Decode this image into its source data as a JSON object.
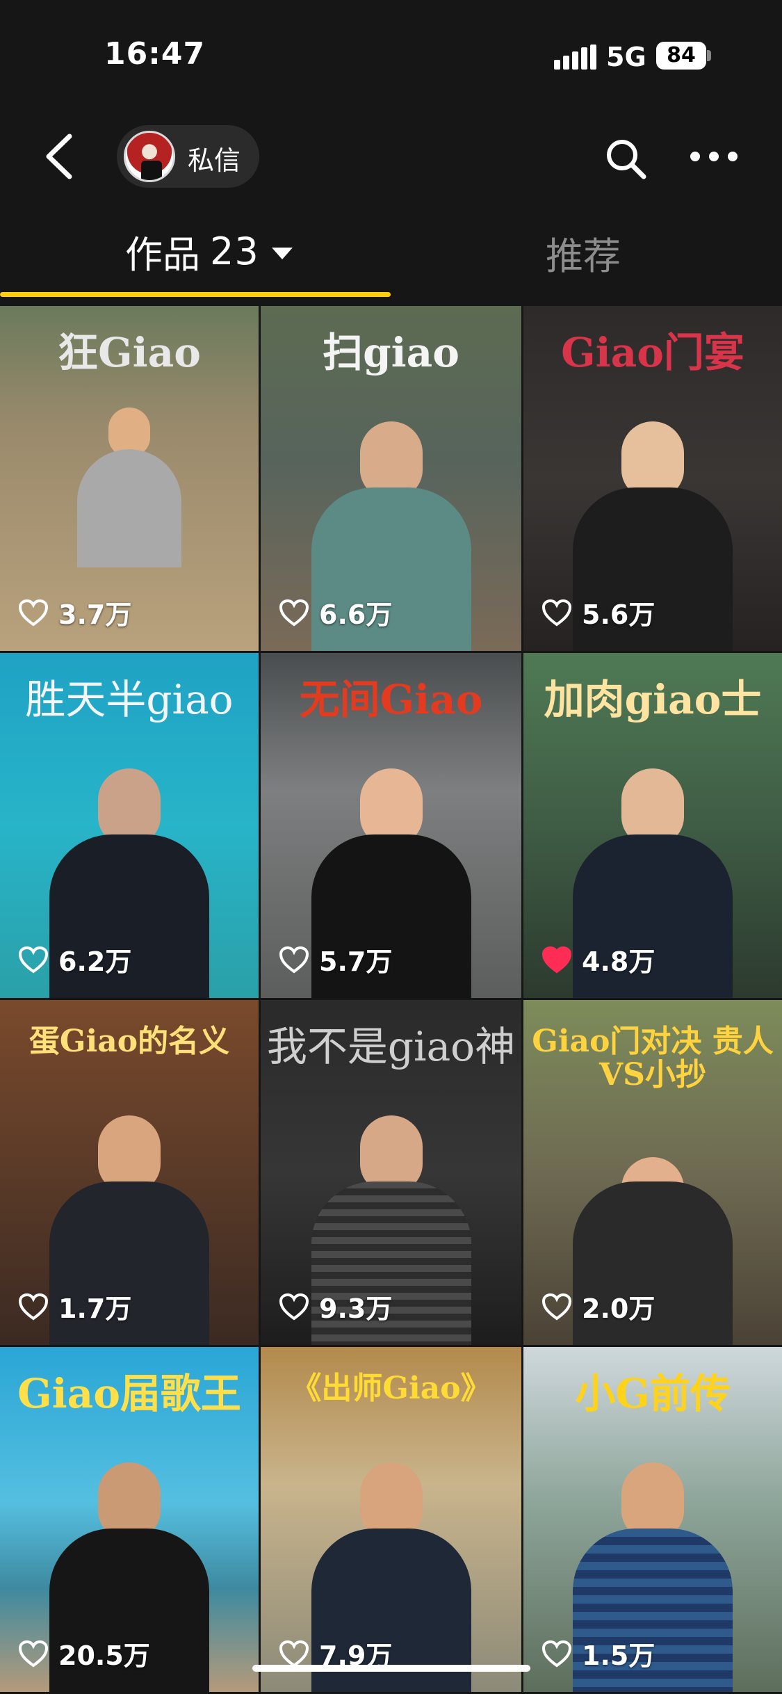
{
  "status_bar": {
    "time": "16:47",
    "network": "5G",
    "battery": "84"
  },
  "header": {
    "chat_label": "私信"
  },
  "tabs": {
    "works_label": "作品",
    "works_count": "23",
    "recommend_label": "推荐"
  },
  "colors": {
    "accent": "#ffcf0d",
    "liked": "#ff2d55"
  },
  "videos": [
    {
      "title": "狂Giao",
      "likes": "3.7万",
      "liked": false
    },
    {
      "title": "扫giao",
      "likes": "6.6万",
      "liked": false
    },
    {
      "title": "Giao门宴",
      "likes": "5.6万",
      "liked": false
    },
    {
      "title": "胜天半giao",
      "likes": "6.2万",
      "liked": false
    },
    {
      "title": "无间Giao",
      "likes": "5.7万",
      "liked": false
    },
    {
      "title": "加肉giao士",
      "likes": "4.8万",
      "liked": true
    },
    {
      "title": "蛋Giao的名义",
      "likes": "1.7万",
      "liked": false
    },
    {
      "title": "我不是giao神",
      "likes": "9.3万",
      "liked": false
    },
    {
      "title": "Giao门对决 贵人VS小抄",
      "likes": "2.0万",
      "liked": false
    },
    {
      "title": "Giao届歌王",
      "likes": "20.5万",
      "liked": false
    },
    {
      "title": "《出师Giao》",
      "likes": "7.9万",
      "liked": false
    },
    {
      "title": "小G前传",
      "likes": "1.5万",
      "liked": false
    }
  ]
}
